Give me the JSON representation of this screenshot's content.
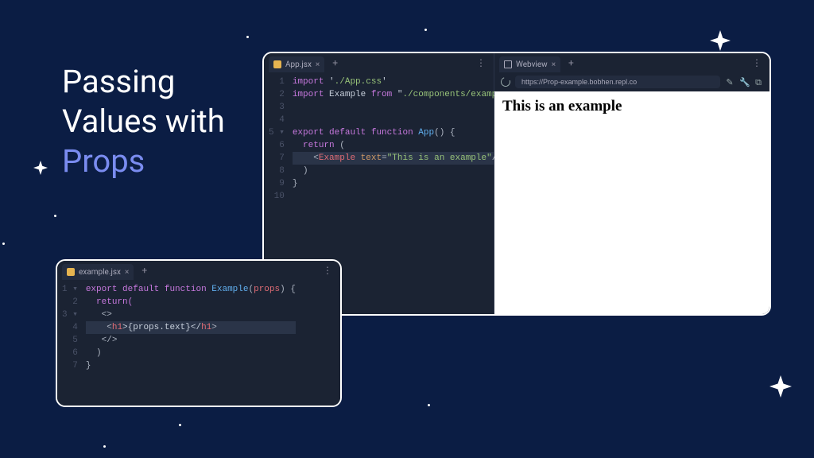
{
  "title": {
    "line1": "Passing",
    "line2": "Values with",
    "line3": "Props"
  },
  "mainEditor": {
    "tabLabel": "App.jsx",
    "gutter": "1\n2\n3\n4\n5 ▾\n6\n7\n8\n9\n10",
    "code": {
      "l1a": "import",
      "l1b": " '",
      "l1c": "./App.css",
      "l1d": "'",
      "l2a": "import",
      "l2b": " Example ",
      "l2c": "from",
      "l2d": " \"",
      "l2e": "./components/example",
      "l2f": "\"",
      "l5a": "export",
      "l5b": " default ",
      "l5c": "function",
      "l5d": " ",
      "l5e": "App",
      "l5f": "() {",
      "l6a": "  return",
      "l6b": " (",
      "l7a": "    <",
      "l7b": "Example",
      "l7c": " ",
      "l7d": "text",
      "l7e": "=",
      "l7f": "\"This is an example\"",
      "l7g": "/>",
      "l8": "  )",
      "l9": "}"
    }
  },
  "webview": {
    "tabLabel": "Webview",
    "url": "https://Prop-example.bobhen.repl.co",
    "rendered": "This is an example"
  },
  "exampleEditor": {
    "tabLabel": "example.jsx",
    "gutter": "1 ▾\n2\n3 ▾\n4\n5\n6\n7",
    "code": {
      "l1a": "export",
      "l1b": " default ",
      "l1c": "function",
      "l1d": " ",
      "l1e": "Example",
      "l1f": "(",
      "l1g": "props",
      "l1h": ") {",
      "l2": "  return(",
      "l3": "   <>",
      "l4a": "    <",
      "l4b": "h1",
      "l4c": ">{props.text}</",
      "l4d": "h1",
      "l4e": ">",
      "l5": "   </>",
      "l6": "  )",
      "l7": "}"
    }
  }
}
